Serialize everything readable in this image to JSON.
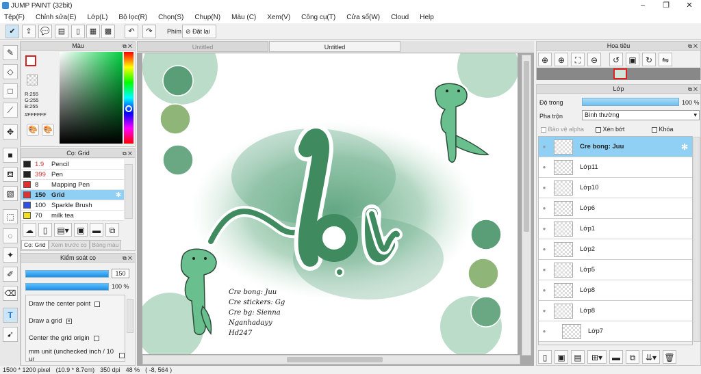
{
  "app": {
    "title": "JUMP PAINT (32bit)"
  },
  "menu": [
    "Tệp(F)",
    "Chỉnh sửa(E)",
    "Lớp(L)",
    "Bộ lọc(R)",
    "Chọn(S)",
    "Chụp(N)",
    "Màu (C)",
    "Xem(V)",
    "Công cụ(T)",
    "Cửa sổ(W)",
    "Cloud",
    "Help"
  ],
  "toolbar": {
    "phim_label": "Phím",
    "reset_label": "Đặt lại"
  },
  "color_panel": {
    "title": "Màu",
    "r": "R:255",
    "g": "G:255",
    "b": "B:255",
    "hex": "#FFFFFF"
  },
  "brush_panel": {
    "title": "Cọ: Grid",
    "brushes": [
      {
        "size": "1.9",
        "name": "Pencil",
        "color": "#222222",
        "size_color": "#d03030"
      },
      {
        "size": "399",
        "name": "Pen",
        "color": "#222222",
        "size_color": "#d03030"
      },
      {
        "size": "8",
        "name": "Mapping Pen",
        "color": "#e03030",
        "size_color": "#222222"
      },
      {
        "size": "150",
        "name": "Grid",
        "color": "#e03030",
        "size_color": "#222222",
        "selected": true
      },
      {
        "size": "100",
        "name": "Sparkle Brush",
        "color": "#3050e0",
        "size_color": "#222222"
      },
      {
        "size": "70",
        "name": "milk tea",
        "color": "#f0e020",
        "size_color": "#222222"
      }
    ],
    "tabs": [
      "Cọ: Grid",
      "Xem trước cọ",
      "Bảng màu"
    ]
  },
  "brush_control": {
    "title": "Kiểm soát cọ",
    "size_value": "150",
    "opacity_value": "100 %",
    "options": [
      {
        "label": "Draw the center point",
        "checked": false
      },
      {
        "label": "Draw a grid",
        "checked": true
      },
      {
        "label": "Center the grid origin",
        "checked": false
      },
      {
        "label": "mm unit (unchecked inch / 10 ur",
        "checked": false
      }
    ]
  },
  "document_tabs": [
    {
      "label": "Untitled",
      "active": false
    },
    {
      "label": "Untitled",
      "active": true
    }
  ],
  "artwork": {
    "title": "lọ",
    "credits": [
      "Cre bong: Juu",
      "Cre stickers: Gg",
      "Cre bg: Sienna",
      "Nganhadayy",
      "Hd247"
    ]
  },
  "navigator": {
    "title": "Hoa tiêu"
  },
  "layer_panel": {
    "title": "Lớp",
    "opacity_label": "Độ trong",
    "opacity_value": "100 %",
    "blend_label": "Pha trộn",
    "blend_value": "Bình thường",
    "protect_alpha": "Bảo vệ alpha",
    "clipping": "Xén bớt",
    "lock": "Khóa",
    "layers": [
      {
        "name": "Cre bong: Juu",
        "selected": true
      },
      {
        "name": "Lớp11"
      },
      {
        "name": "Lớp10"
      },
      {
        "name": "Lớp6"
      },
      {
        "name": "Lớp1"
      },
      {
        "name": "Lớp2"
      },
      {
        "name": "Lớp5"
      },
      {
        "name": "Lớp8"
      },
      {
        "name": "Lớp8"
      },
      {
        "name": "Lớp7"
      }
    ]
  },
  "status": {
    "size": "1500 * 1200 pixel",
    "dimensions": "(10.9 * 8.7cm)",
    "dpi": "350 dpi",
    "zoom": "48 %",
    "coords": "( -8, 564 )"
  },
  "colors": {
    "accent": "#8fd0f4",
    "green": "#4a9a6e",
    "light_green": "#a8d5bd"
  }
}
